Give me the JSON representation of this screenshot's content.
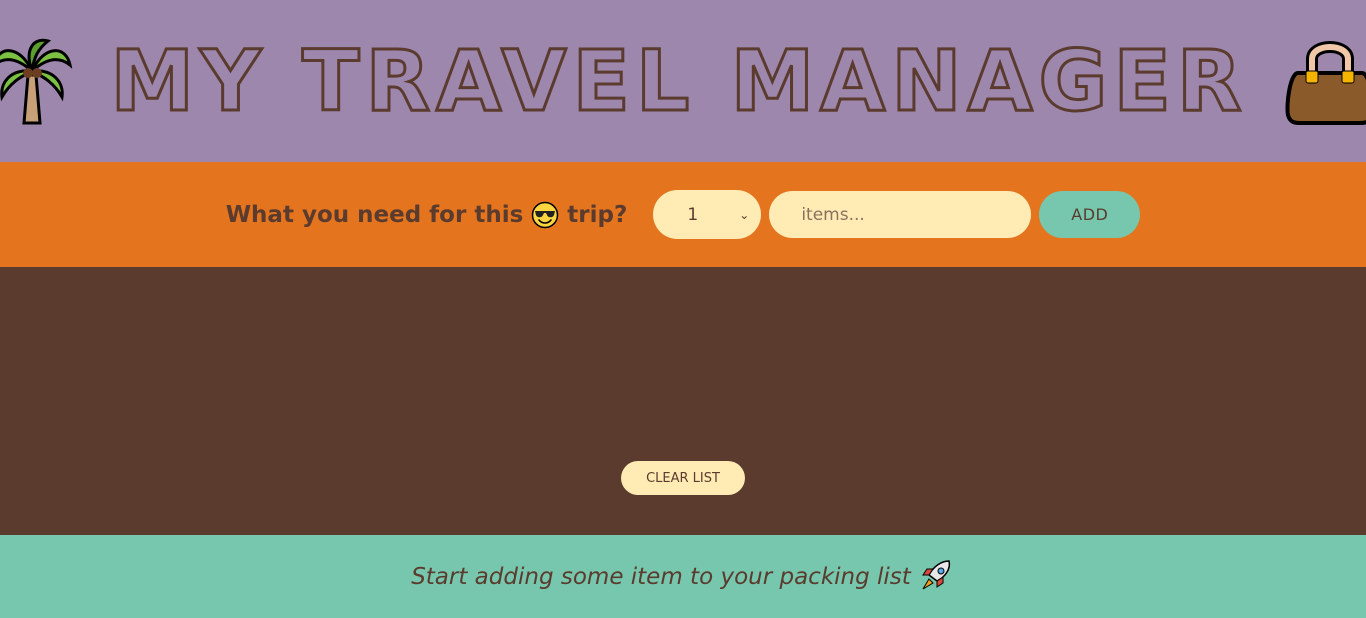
{
  "header": {
    "title": "My Travel Manager",
    "left_icon": "palm-tree-icon",
    "right_icon": "handbag-icon"
  },
  "add_form": {
    "question": "What you need for this",
    "question_suffix": "trip?",
    "emoji": "sunglasses-face-icon",
    "quantity_selected": "1",
    "item_placeholder": "items...",
    "add_label": "Add"
  },
  "list": {
    "items": [],
    "clear_label": "Clear list"
  },
  "footer": {
    "message": "Start adding some item to your packing list",
    "emoji": "rocket-icon"
  },
  "colors": {
    "header_bg": "#9d87ad",
    "form_bg": "#e4751e",
    "list_bg": "#5a3b2e",
    "footer_bg": "#76c7ad",
    "input_bg": "#ffebb3",
    "text_brown": "#5a3b2e"
  }
}
